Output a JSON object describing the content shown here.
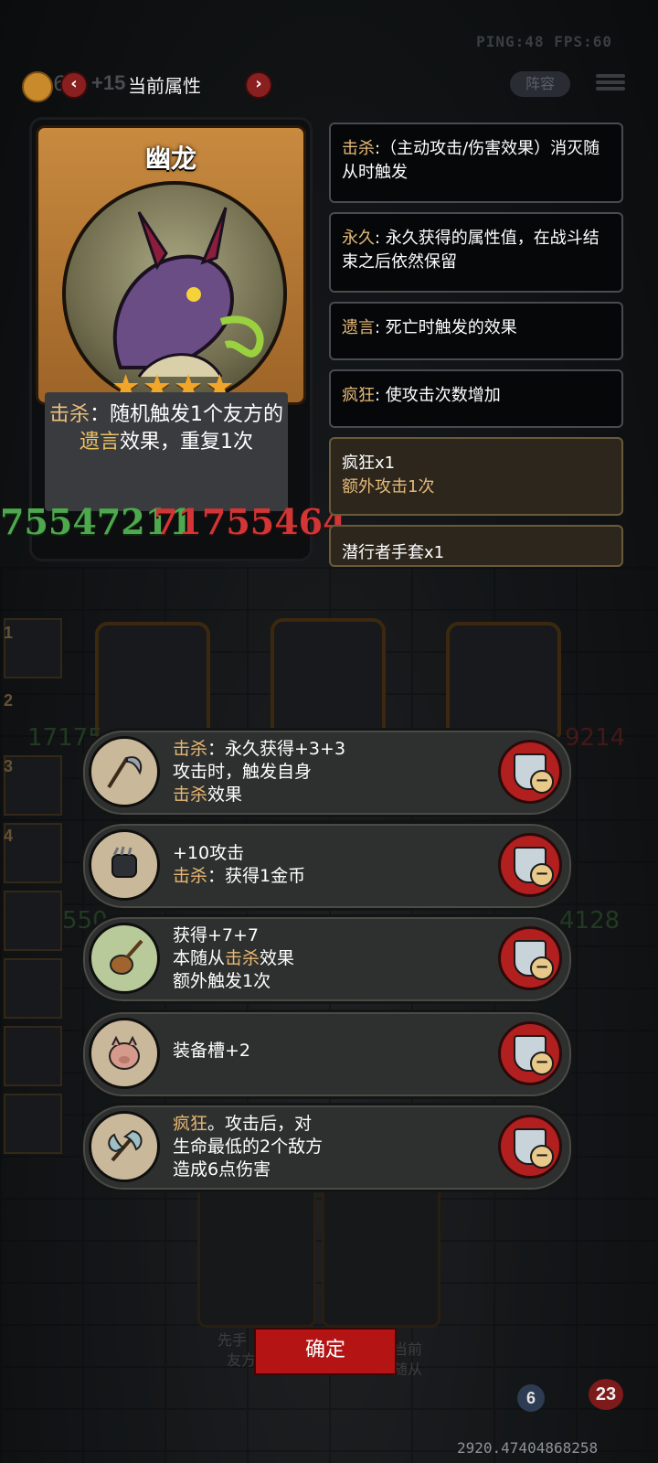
{
  "status": {
    "ping_fps": "PING:48  FPS:60"
  },
  "header": {
    "gold_partial": "6",
    "gold_income": "+15",
    "title": "当前属性",
    "prev_arrow": "‹",
    "next_arrow": "›",
    "lineup_label": "阵容"
  },
  "card": {
    "name": "幽龙",
    "stars": "★★★★",
    "desc_kill": "击杀",
    "desc_part1": "：随机触发1个友方的",
    "desc_death": "遗言",
    "desc_part2": "效果，重复1次",
    "damage_green": "75547211",
    "damage_red": "71755464"
  },
  "keywords": [
    {
      "key": "击杀",
      "text": ":（主动攻击/伤害效果）消灭随从时触发"
    },
    {
      "key": "永久",
      "text": ": 永久获得的属性值，在战斗结束之后依然保留"
    },
    {
      "key": "遗言",
      "text": ": 死亡时触发的效果"
    },
    {
      "key": "疯狂",
      "text": ": 使攻击次数增加"
    }
  ],
  "buffs": [
    {
      "title": "疯狂x1",
      "sub": "额外攻击1次"
    },
    {
      "title": "潜行者手套x1",
      "sub": ""
    }
  ],
  "equipment": [
    {
      "icon": "scythe-icon",
      "glyph": "⚒",
      "line1_k": "击杀",
      "line1": "：永久获得+3+3",
      "line2": "攻击时，触发自身",
      "line3_k": "击杀",
      "line3": "效果"
    },
    {
      "icon": "gauntlet-icon",
      "glyph": "✊",
      "line1_k": "",
      "line1": "+10攻击",
      "line2_k": "击杀",
      "line2": "：获得1金币"
    },
    {
      "icon": "lute-icon",
      "glyph": "♪",
      "line1_k": "",
      "line1": "获得+7+7",
      "line2a": "本随从",
      "line2_k": "击杀",
      "line2b": "效果",
      "line3": "额外触发1次"
    },
    {
      "icon": "pig-icon",
      "glyph": "🐖",
      "line1": "装备槽+2"
    },
    {
      "icon": "axe-icon",
      "glyph": "⚔",
      "line1_k": "疯狂",
      "line1": "。攻击后，对",
      "line2": "生命最低的2个敌方",
      "line3": "造成6点伤害"
    }
  ],
  "bg": {
    "team_numbers": [
      "1",
      "2",
      "3",
      "4"
    ],
    "side_damage_left": "17175",
    "side_damage_right": "9214",
    "side_damage_left2": "550",
    "side_damage_right2": "4128",
    "bottom_left_text1": "先手",
    "bottom_left_text2": "友方",
    "bottom_right_text1": "当前",
    "bottom_right_text2": "随从"
  },
  "footer": {
    "confirm_label": "确定",
    "coins": "2920.47404868258",
    "badge_blue": "6",
    "badge_red": "23"
  }
}
